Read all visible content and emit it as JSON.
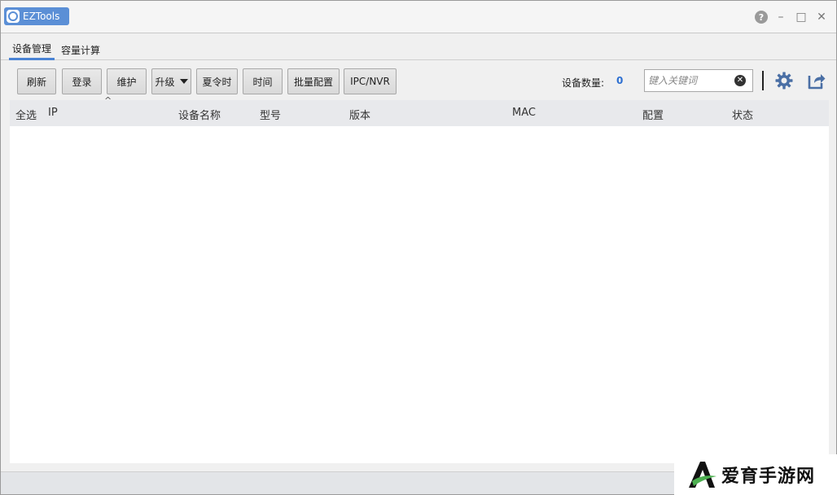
{
  "app": {
    "title": "EZTools",
    "window_controls": {
      "help": "?",
      "minimize": "–",
      "maximize": "□",
      "close": "✕"
    }
  },
  "tabs": [
    {
      "label": "设备管理",
      "active": true
    },
    {
      "label": "容量计算",
      "active": false
    }
  ],
  "toolbar": {
    "refresh": "刷新",
    "login": "登录",
    "maintain": "维护",
    "upgrade": "升级",
    "dst": "夏令时",
    "time": "时间",
    "batch_config": "批量配置",
    "ipc_nvr": "IPC/NVR",
    "device_count_label": "设备数量:",
    "device_count": "0",
    "search_placeholder": "键入关键词",
    "icons": [
      "settings-icon",
      "export-icon"
    ]
  },
  "table": {
    "columns": [
      "全选",
      "IP",
      "设备名称",
      "型号",
      "版本",
      "MAC",
      "配置",
      "状态"
    ],
    "sort_indicator": "^",
    "rows": []
  },
  "watermark": {
    "text": "爱育手游网"
  },
  "colors": {
    "accent": "#4a83d4",
    "badge": "#5b8fd6",
    "count": "#2d6fd1"
  }
}
